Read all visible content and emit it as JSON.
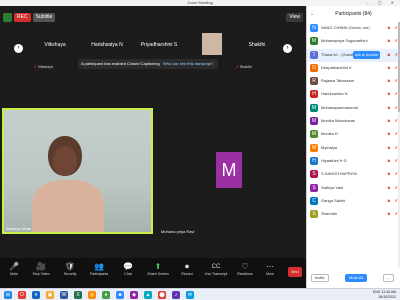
{
  "window": {
    "title": "Zoom Meeting"
  },
  "chips": {
    "rec": "REC",
    "subtitles": "Subtitle"
  },
  "view_label": "View",
  "strip": {
    "tiles": [
      {
        "name": "Vilkshaya",
        "bottom": "Vilkshaya"
      },
      {
        "name": "Harishsatya N",
        "bottom": "Harishsatya N"
      },
      {
        "name": "Priyadharshini S",
        "bottom": "Priyadharshini S"
      },
      {
        "name": "",
        "bottom": ""
      },
      {
        "name": "Shakthi",
        "bottom": "Shakthi"
      }
    ]
  },
  "cc_banner": {
    "text": "A participant has enabled Closed Captioning",
    "link": "Who can see this transcript?"
  },
  "main_video": {
    "caption": "Abinaya Nmai"
  },
  "avatar_tile": {
    "letter": "M",
    "caption": "Mohana priya Ravi"
  },
  "toolbar": {
    "items": [
      {
        "icon": "🎤",
        "label": "Mute"
      },
      {
        "icon": "🎥",
        "label": "Stop Video"
      },
      {
        "icon": "🛡",
        "label": "Security"
      },
      {
        "icon": "👥",
        "label": "Participants"
      },
      {
        "icon": "💬",
        "label": "Chat"
      },
      {
        "icon": "⬆",
        "label": "Share Screen"
      },
      {
        "icon": "⏺",
        "label": "Record"
      },
      {
        "icon": "CC",
        "label": "Live Transcript"
      },
      {
        "icon": "♡",
        "label": "Reactions"
      },
      {
        "icon": "⋯",
        "label": "More"
      }
    ],
    "end_label": "End"
  },
  "panel": {
    "title": "Participants (84)",
    "ask_label": "Ask to Unmute",
    "participants": [
      {
        "initial": "N",
        "color": "#2d8cff",
        "name": "NANG CHINNI (Guest, me)"
      },
      {
        "initial": "M",
        "color": "#2e7d32",
        "name": "Mohanapriya Sugavarthini"
      },
      {
        "initial": "T",
        "color": "#5b6fd6",
        "name": "Tharai M... (Guest)",
        "highlight": true
      },
      {
        "initial": "D",
        "color": "#ef6c00",
        "name": "Deepatharshini K"
      },
      {
        "initial": "R",
        "color": "#6d4c41",
        "name": "Rajaara Tabassum"
      },
      {
        "initial": "H",
        "color": "#c62828",
        "name": "Harinivarsha N"
      },
      {
        "initial": "M",
        "color": "#00897b",
        "name": "Mohanapaurnammal"
      },
      {
        "initial": "M",
        "color": "#7b1fa2",
        "name": "Monika Manoharan"
      },
      {
        "initial": "M",
        "color": "#558b2f",
        "name": "Monika D"
      },
      {
        "initial": "M",
        "color": "#f57c00",
        "name": "Mythaiya"
      },
      {
        "initial": "H",
        "color": "#1976d2",
        "name": "Hiyaathini H G"
      },
      {
        "initial": "S",
        "color": "#ad1457",
        "name": "S.SANGITHAPRIYA"
      },
      {
        "initial": "S",
        "color": "#8e24aa",
        "name": "Sathiya Vani"
      },
      {
        "initial": "C",
        "color": "#0277bd",
        "name": "Ganga Sakthi"
      },
      {
        "initial": "S",
        "color": "#9e9d24",
        "name": "Sharmila"
      }
    ],
    "footer": {
      "invite": "Invite",
      "mute_all": "Mute All",
      "more": "..."
    }
  },
  "taskbar": {
    "icons": [
      {
        "glyph": "⊞",
        "color": "#1e88e5"
      },
      {
        "glyph": "O",
        "color": "#e53935"
      },
      {
        "glyph": "e",
        "color": "#1565c0"
      },
      {
        "glyph": "▣",
        "color": "#f9a825"
      },
      {
        "glyph": "W",
        "color": "#2b579a"
      },
      {
        "glyph": "X",
        "color": "#217346"
      },
      {
        "glyph": "◎",
        "color": "#fb8c00"
      },
      {
        "glyph": "●",
        "color": "#43a047"
      },
      {
        "glyph": "■",
        "color": "#2d8cff"
      },
      {
        "glyph": "◆",
        "color": "#8e24aa"
      },
      {
        "glyph": "▲",
        "color": "#00acc1"
      },
      {
        "glyph": "⬤",
        "color": "#e53935"
      },
      {
        "glyph": "♪",
        "color": "#5e35b1"
      },
      {
        "glyph": "✉",
        "color": "#039be5"
      }
    ],
    "time": "11:44 AM",
    "date": "26/10/2021",
    "lang": "ENG"
  }
}
